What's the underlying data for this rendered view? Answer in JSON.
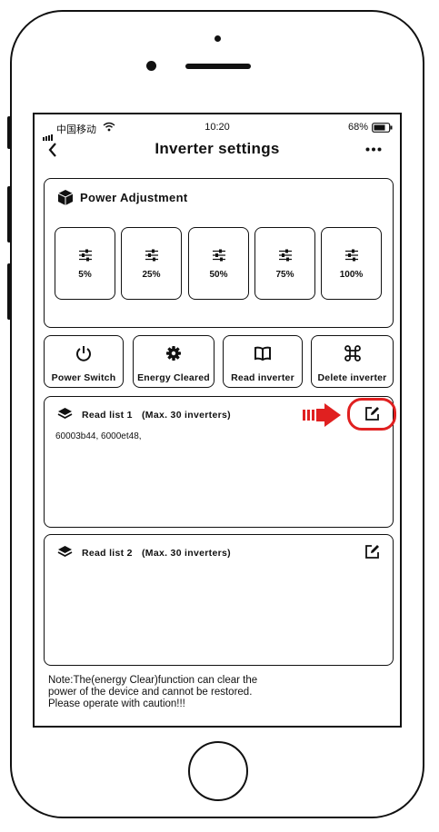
{
  "status_bar": {
    "carrier": "中国移动",
    "time": "10:20",
    "battery": "68%"
  },
  "header": {
    "title": "Inverter settings",
    "back_icon": "chevron-left-icon",
    "more_icon": "more-icon"
  },
  "power_adjustment": {
    "title": "Power Adjustment",
    "icon": "cube-icon",
    "options": [
      {
        "label": "5%"
      },
      {
        "label": "25%"
      },
      {
        "label": "50%"
      },
      {
        "label": "75%"
      },
      {
        "label": "100%"
      }
    ]
  },
  "actions": [
    {
      "label": "Power Switch",
      "icon": "power-icon"
    },
    {
      "label": "Energy Cleared",
      "icon": "gear-icon"
    },
    {
      "label": "Read inverter",
      "icon": "book-icon"
    },
    {
      "label": "Delete inverter",
      "icon": "command-icon"
    }
  ],
  "read_lists": [
    {
      "title": "Read list 1",
      "max": "(Max. 30 inverters)",
      "items": "60003b44, 6000et48,",
      "highlight_color": "#e02020"
    },
    {
      "title": "Read list 2",
      "max": "(Max. 30 inverters)",
      "items": ""
    }
  ],
  "note": {
    "line1": "Note:The(energy Clear)function can clear the",
    "line2": "power of the device and cannot be restored.",
    "line3": "Please operate with caution!!!"
  }
}
